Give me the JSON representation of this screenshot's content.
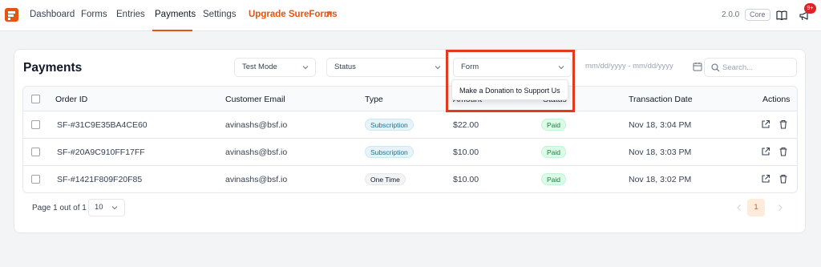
{
  "nav": {
    "items": [
      {
        "label": "Dashboard"
      },
      {
        "label": "Forms"
      },
      {
        "label": "Entries"
      },
      {
        "label": "Payments"
      },
      {
        "label": "Settings"
      }
    ],
    "active": "Payments",
    "upgrade_label": "Upgrade SureForms",
    "version": "2.0.0",
    "plan_badge": "Core",
    "notification_count": "9+"
  },
  "colors": {
    "brand": "#e8530e",
    "paid": "#15803d",
    "highlight": "#e33a1f"
  },
  "page": {
    "title": "Payments",
    "filters": {
      "mode": "Test Mode",
      "status": "Status",
      "form": "Form",
      "date_placeholder": "mm/dd/yyyy - mm/dd/yyyy",
      "search_placeholder": "Search..."
    },
    "form_dropdown_options": [
      "Make a Donation to Support Us"
    ]
  },
  "table": {
    "columns": [
      "Order ID",
      "Customer Email",
      "Type",
      "Amount",
      "Status",
      "Transaction Date",
      "Actions"
    ],
    "rows": [
      {
        "order_id": "SF-#31C9E35BA4CE60",
        "email": "avinashs@bsf.io",
        "type": "Subscription",
        "amount": "$22.00",
        "status": "Paid",
        "date": "Nov 18, 3:04 PM"
      },
      {
        "order_id": "SF-#20A9C910FF17FF",
        "email": "avinashs@bsf.io",
        "type": "Subscription",
        "amount": "$10.00",
        "status": "Paid",
        "date": "Nov 18, 3:03 PM"
      },
      {
        "order_id": "SF-#1421F809F20F85",
        "email": "avinashs@bsf.io",
        "type": "One Time",
        "amount": "$10.00",
        "status": "Paid",
        "date": "Nov 18, 3:02 PM"
      }
    ]
  },
  "pagination": {
    "summary": "Page 1 out of 1",
    "per_page": "10",
    "current_page": "1"
  }
}
